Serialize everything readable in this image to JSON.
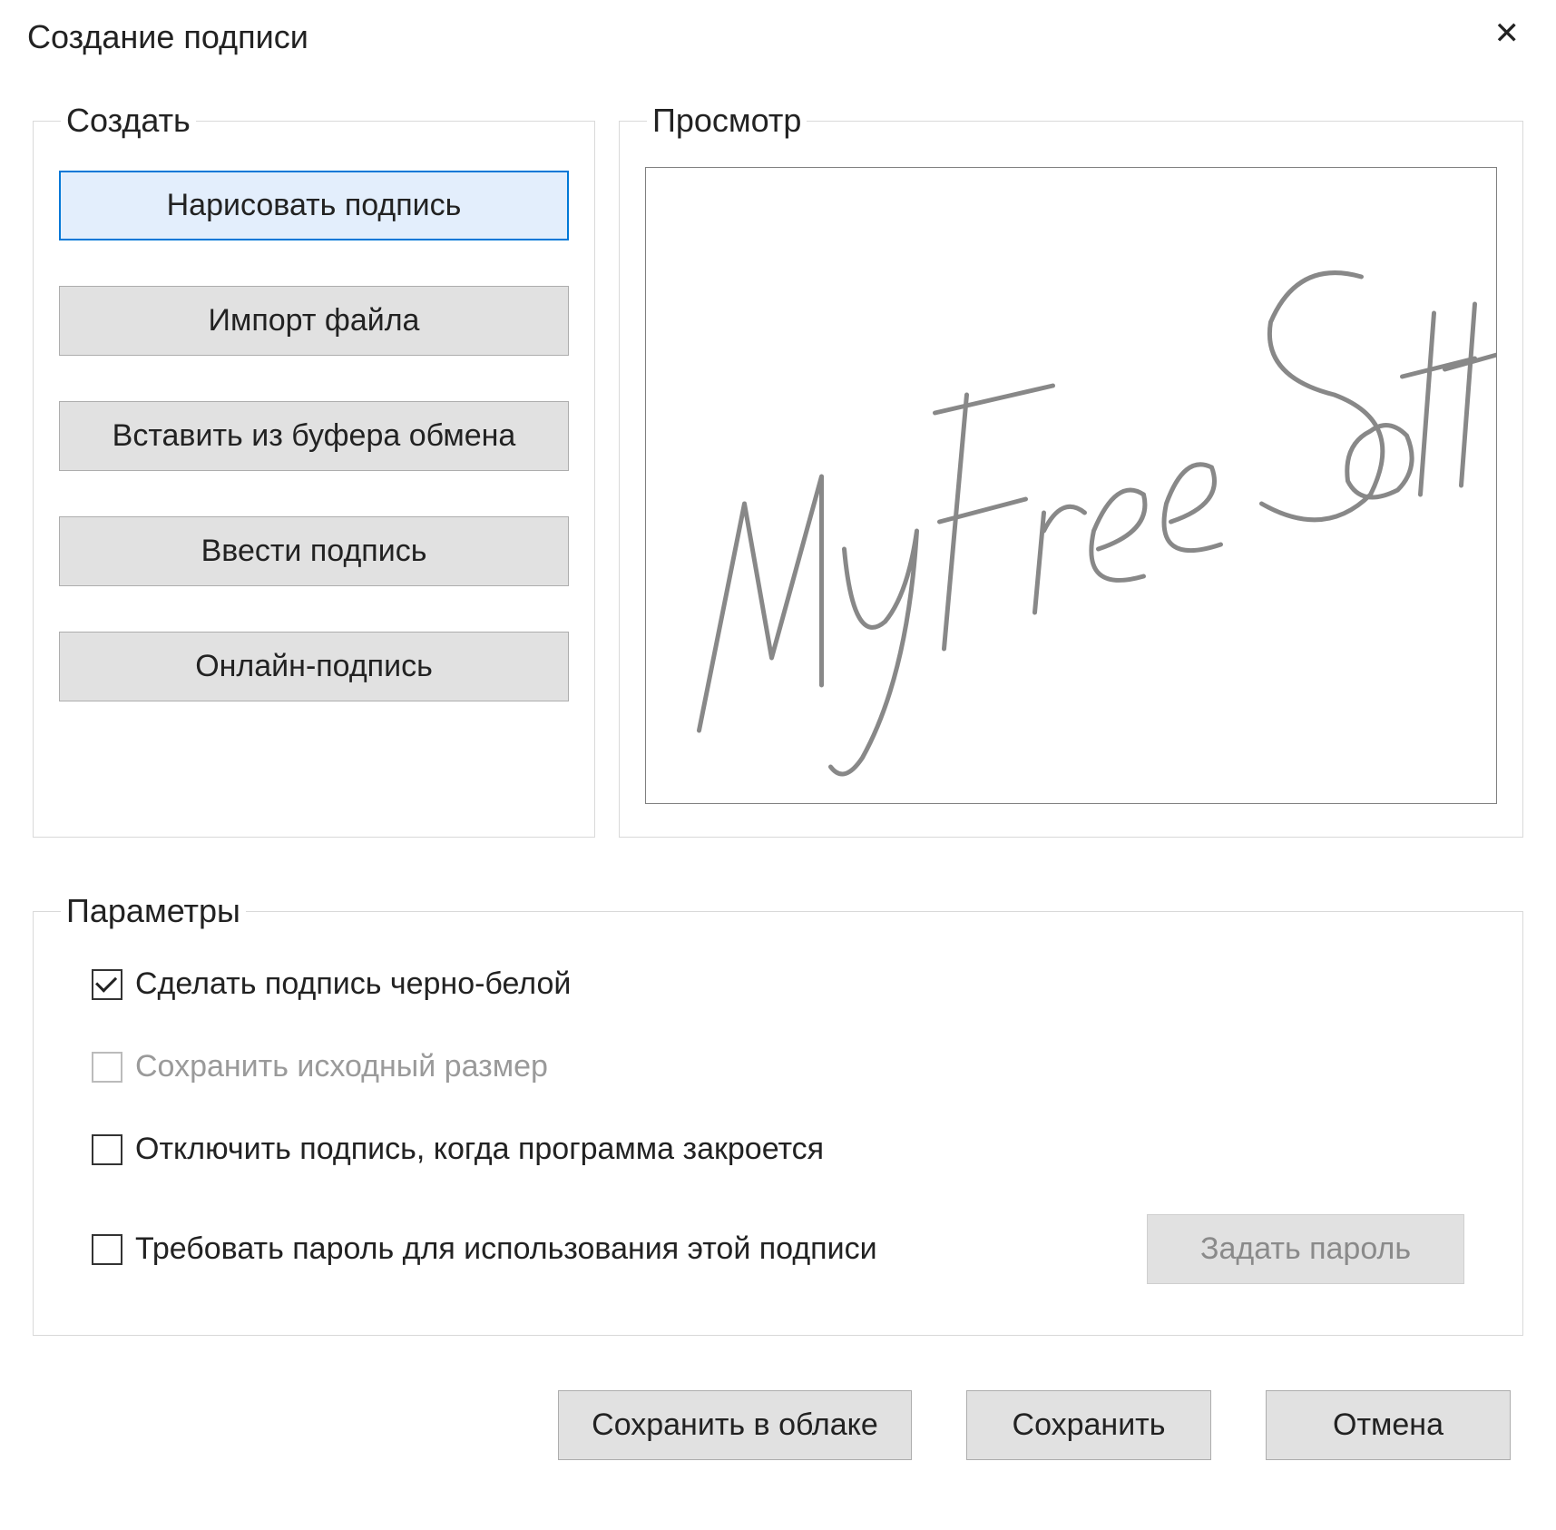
{
  "dialog": {
    "title": "Создание подписи"
  },
  "create": {
    "legend": "Создать",
    "buttons": {
      "draw": "Нарисовать подпись",
      "import": "Импорт файла",
      "paste": "Вставить из буфера обмена",
      "type": "Ввести подпись",
      "online": "Онлайн-подпись"
    }
  },
  "preview": {
    "legend": "Просмотр",
    "signature_text": "My Free Soft"
  },
  "options": {
    "legend": "Параметры",
    "bw": "Сделать подпись черно-белой",
    "keep_size": "Сохранить исходный размер",
    "discard_on_close": "Отключить подпись, когда программа закроется",
    "require_password": "Требовать пароль для использования этой подписи",
    "set_password_btn": "Задать пароль"
  },
  "footer": {
    "save_cloud": "Сохранить в облаке",
    "save": "Сохранить",
    "cancel": "Отмена"
  }
}
